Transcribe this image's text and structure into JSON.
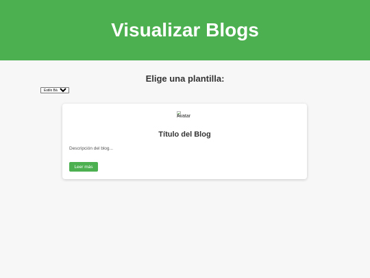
{
  "header": {
    "title": "Visualizar Blogs"
  },
  "template_picker": {
    "prompt": "Elige una plantilla:",
    "selected": "Estilo Básico"
  },
  "blog_card": {
    "avatar_alt": "Avatar",
    "title": "Título del Blog",
    "description": "Descripción del blog...",
    "read_more_label": "Leer más"
  },
  "colors": {
    "accent": "#4caf50",
    "background": "#f7f7f7"
  }
}
